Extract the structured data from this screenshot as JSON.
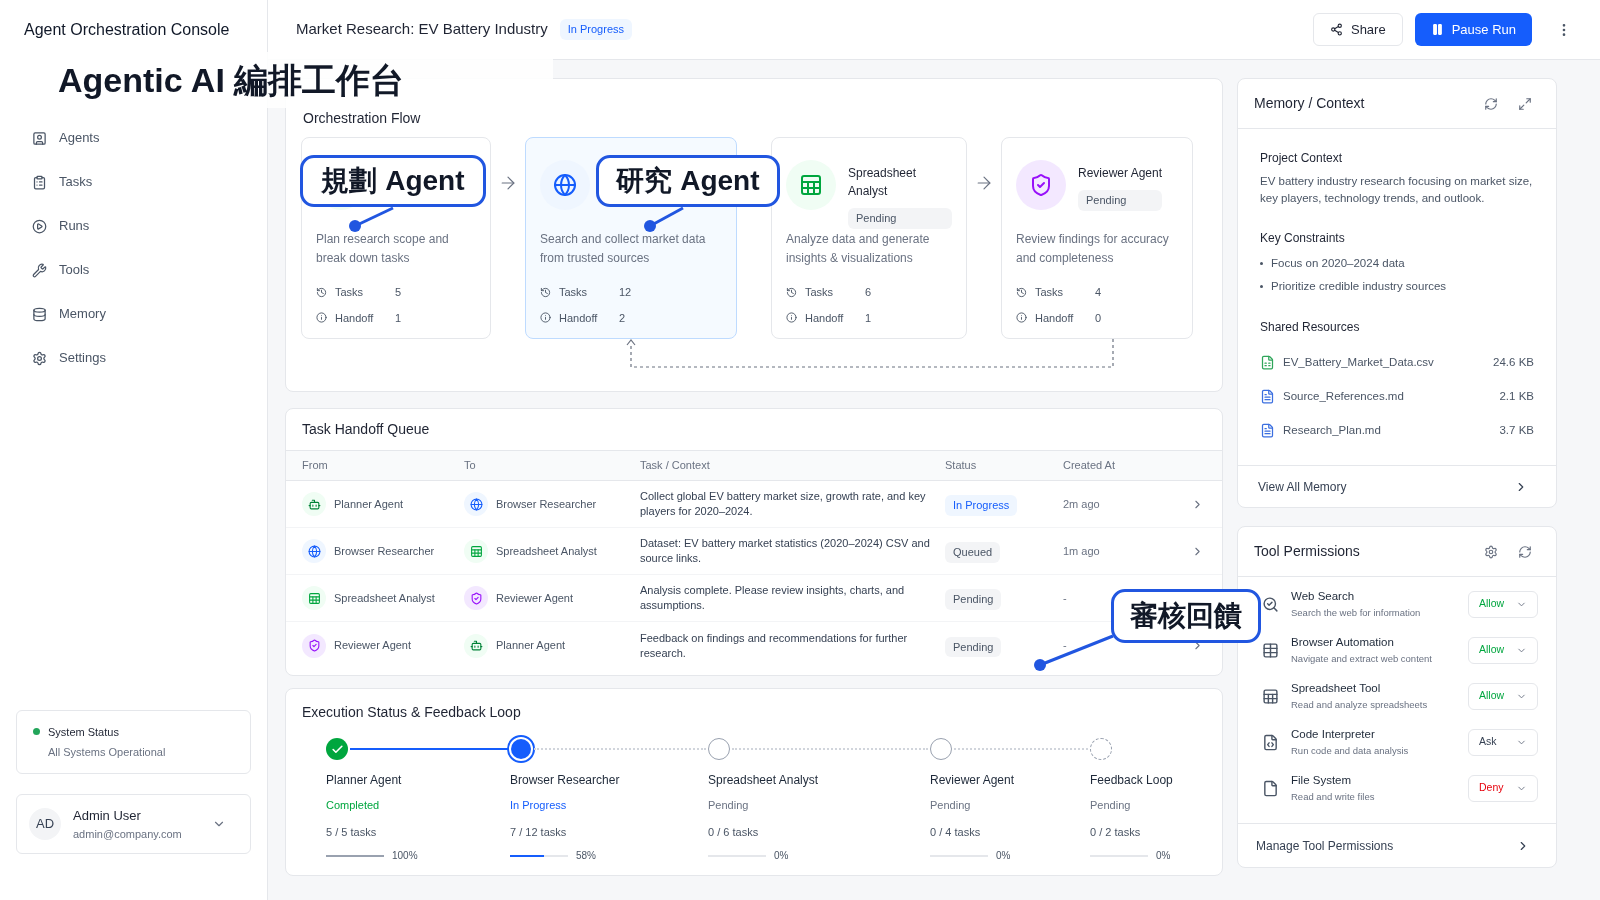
{
  "sidebar": {
    "title": "Agent Orchestration Console",
    "items": [
      {
        "label": "Agents",
        "kind": "agents",
        "selected": false
      },
      {
        "label": "Tasks",
        "kind": "tasks",
        "selected": false
      },
      {
        "label": "Runs",
        "kind": "runs",
        "selected": false
      },
      {
        "label": "Tools",
        "kind": "tools",
        "selected": false
      },
      {
        "label": "Memory",
        "kind": "memory",
        "selected": false
      },
      {
        "label": "Settings",
        "kind": "settings",
        "selected": false
      }
    ],
    "system_status": {
      "title": "System Status",
      "text": "All Systems Operational",
      "color": "#22a55a"
    },
    "user": {
      "initials": "AD",
      "name": "Admin User",
      "email": "admin@company.com"
    }
  },
  "header": {
    "title": "Market Research: EV Battery Industry",
    "status": {
      "label": "In Progress",
      "kind": "in_progress"
    },
    "buttons": [
      {
        "label": "Share",
        "kind": "secondary"
      },
      {
        "label": "Pause Run",
        "kind": "primary"
      }
    ]
  },
  "flow": {
    "title": "Orchestration Flow",
    "cards": [
      {
        "kind": "planner",
        "description": "Plan research scope and break down tasks",
        "stats": [
          {
            "label": "Tasks",
            "value": "5"
          },
          {
            "label": "Handoff",
            "value": "1"
          }
        ],
        "selected": false
      },
      {
        "kind": "browser",
        "description": "Search and collect market data from trusted sources",
        "stats": [
          {
            "label": "Tasks",
            "value": "12"
          },
          {
            "label": "Handoff",
            "value": "2"
          }
        ],
        "selected": true
      },
      {
        "kind": "spreadsheet",
        "name": "Spreadsheet Analyst",
        "status": {
          "label": "Pending",
          "kind": "pending"
        },
        "description": "Analyze data and generate insights & visualizations",
        "stats": [
          {
            "label": "Tasks",
            "value": "6"
          },
          {
            "label": "Handoff",
            "value": "1"
          }
        ],
        "selected": false
      },
      {
        "kind": "reviewer",
        "name": "Reviewer Agent",
        "status": {
          "label": "Pending",
          "kind": "pending"
        },
        "description": "Review findings for accuracy and completeness",
        "stats": [
          {
            "label": "Tasks",
            "value": "4"
          },
          {
            "label": "Handoff",
            "value": "0"
          }
        ],
        "selected": false
      }
    ]
  },
  "queue": {
    "title": "Task Handoff Queue",
    "columns": [
      "From",
      "To",
      "Task / Context",
      "Status",
      "Created At"
    ],
    "rows": [
      {
        "from": {
          "name": "Planner Agent",
          "kind": "planner"
        },
        "to": {
          "name": "Browser Researcher",
          "kind": "browser"
        },
        "task": "Collect global EV battery market size, growth rate, and key players for 2020–2024.",
        "status": {
          "label": "In Progress",
          "kind": "in_progress"
        },
        "created": "2m ago"
      },
      {
        "from": {
          "name": "Browser Researcher",
          "kind": "browser"
        },
        "to": {
          "name": "Spreadsheet Analyst",
          "kind": "spreadsheet"
        },
        "task": "Dataset: EV battery market statistics (2020–2024) CSV and source links.",
        "status": {
          "label": "Queued",
          "kind": "queued"
        },
        "created": "1m ago"
      },
      {
        "from": {
          "name": "Spreadsheet Analyst",
          "kind": "spreadsheet"
        },
        "to": {
          "name": "Reviewer Agent",
          "kind": "reviewer"
        },
        "task": "Analysis complete. Please review insights, charts, and assumptions.",
        "status": {
          "label": "Pending",
          "kind": "pending"
        },
        "created": "-"
      },
      {
        "from": {
          "name": "Reviewer Agent",
          "kind": "reviewer"
        },
        "to": {
          "name": "Planner Agent",
          "kind": "planner"
        },
        "task": "Feedback on findings and recommendations for further research.",
        "status": {
          "label": "Pending",
          "kind": "pending"
        },
        "created": "-"
      }
    ]
  },
  "execution": {
    "title": "Execution Status & Feedback Loop",
    "steps": [
      {
        "name": "Planner Agent",
        "status": {
          "label": "Completed",
          "kind": "completed"
        },
        "tasks": "5 / 5 tasks",
        "level": 1,
        "percent": "100%",
        "kind": "agent"
      },
      {
        "name": "Browser Researcher",
        "status": {
          "label": "In Progress",
          "kind": "in_progress"
        },
        "tasks": "7 / 12 tasks",
        "level": 0.58,
        "percent": "58%",
        "kind": "agent"
      },
      {
        "name": "Spreadsheet Analyst",
        "status": {
          "label": "Pending",
          "kind": "pending"
        },
        "tasks": "0 / 6 tasks",
        "level": 0,
        "percent": "0%",
        "kind": "agent"
      },
      {
        "name": "Reviewer Agent",
        "status": {
          "label": "Pending",
          "kind": "pending"
        },
        "tasks": "0 / 4 tasks",
        "level": 0,
        "percent": "0%",
        "kind": "agent"
      },
      {
        "name": "Feedback Loop",
        "status": {
          "label": "Pending",
          "kind": "pending"
        },
        "tasks": "0 / 2 tasks",
        "level": 0,
        "percent": "0%",
        "kind": "loop"
      }
    ]
  },
  "memory": {
    "title": "Memory / Context",
    "project_title": "Project Context",
    "project_text": "EV battery industry research focusing on market size, key players, technology trends, and outlook.",
    "constraints_title": "Key Constraints",
    "constraints": [
      "Focus on 2020–2024 data",
      "Prioritize credible industry sources"
    ],
    "resources_title": "Shared Resources",
    "files": [
      {
        "name": "EV_Battery_Market_Data.csv",
        "size": "24.6 KB",
        "color": "#2fa55a"
      },
      {
        "name": "Source_References.md",
        "size": "2.1 KB",
        "color": "#3b6fe0"
      },
      {
        "name": "Research_Plan.md",
        "size": "3.7 KB",
        "color": "#3b6fe0"
      }
    ],
    "footer": "View All Memory"
  },
  "tools": {
    "title": "Tool Permissions",
    "items": [
      {
        "name": "Web Search",
        "description": "Search the web for information",
        "kind": "search",
        "permission": {
          "label": "Allow",
          "kind": "allow"
        }
      },
      {
        "name": "Browser Automation",
        "description": "Navigate and extract web content",
        "kind": "browser",
        "permission": {
          "label": "Allow",
          "kind": "allow"
        }
      },
      {
        "name": "Spreadsheet Tool",
        "description": "Read and analyze spreadsheets",
        "kind": "sheet",
        "permission": {
          "label": "Allow",
          "kind": "allow"
        }
      },
      {
        "name": "Code Interpreter",
        "description": "Run code and data analysis",
        "kind": "code",
        "permission": {
          "label": "Ask",
          "kind": "ask"
        }
      },
      {
        "name": "File System",
        "description": "Read and write files",
        "kind": "file",
        "permission": {
          "label": "Deny",
          "kind": "deny"
        }
      }
    ],
    "footer": "Manage Tool Permissions"
  },
  "annotations": [
    {
      "text": "Agentic AI 編排工作台",
      "kind": "banner"
    },
    {
      "text": "規劃 Agent",
      "kind": "callout"
    },
    {
      "text": "研究 Agent",
      "kind": "callout"
    },
    {
      "text": "審核回饋",
      "kind": "callout"
    }
  ]
}
